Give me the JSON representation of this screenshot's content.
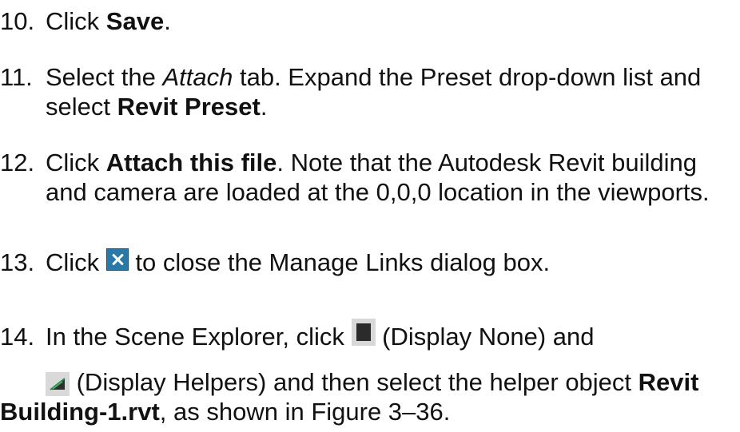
{
  "steps": [
    {
      "num": "10.",
      "t1": "Click ",
      "b1": "Save",
      "t2": "."
    },
    {
      "num": "11.",
      "t1": "Select the ",
      "i1": "Attach",
      "t2": " tab. Expand the Preset drop-down list and",
      "l2a": "select ",
      "b2": "Revit Preset",
      "l2b": "."
    },
    {
      "num": "12.",
      "t1": "Click ",
      "b1": "Attach this file",
      "t2": ". Note that the Autodesk Revit building",
      "l2": "and camera are loaded at the 0,0,0 location in the viewports."
    },
    {
      "num": "13.",
      "t1": "Click ",
      "t2": " to close the Manage Links dialog box."
    },
    {
      "num": "14.",
      "t1": "In the Scene Explorer, click ",
      "t2": " (Display None) and",
      "l2a": " (Display Helpers) and then select the helper object ",
      "b2": "Revit",
      "l3b": "Building-1.rvt",
      "l3c": ", as shown in Figure 3–36."
    }
  ],
  "icons": {
    "close": "close-icon",
    "display_none": "display-none-icon",
    "display_helpers": "display-helpers-icon"
  }
}
